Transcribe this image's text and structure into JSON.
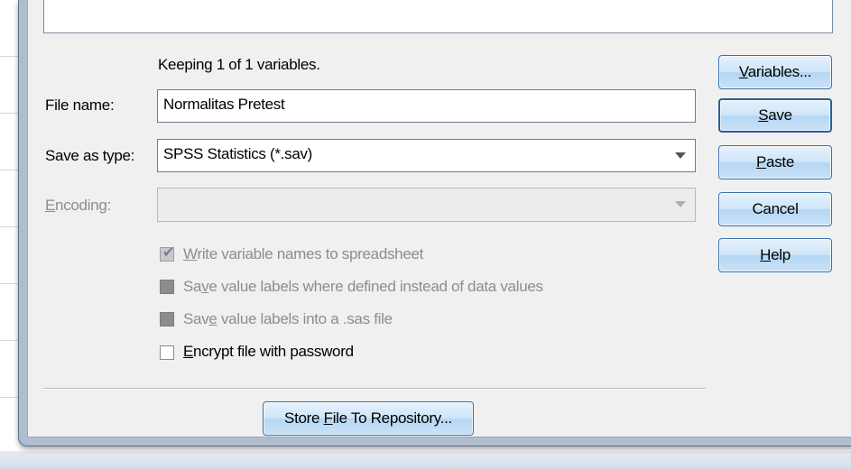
{
  "status": {
    "keeping_text": "Keeping 1 of 1 variables."
  },
  "fields": {
    "file_name_label": "File name:",
    "file_name_value": "Normalitas Pretest",
    "save_as_type_label": "Save as type:",
    "save_as_type_value": "SPSS Statistics (*.sav)",
    "encoding_label_prefix": "",
    "encoding_label_underlined": "E",
    "encoding_label_rest": "ncoding:",
    "encoding_value": ""
  },
  "options": [
    {
      "pre": "",
      "u": "W",
      "post": "rite variable names to spreadsheet",
      "checked": true,
      "enabled": false
    },
    {
      "pre": "Sa",
      "u": "v",
      "post": "e value labels where defined instead of data values",
      "checked": false,
      "enabled": false
    },
    {
      "pre": "Sav",
      "u": "e",
      "post": " value labels into a .sas file",
      "checked": false,
      "enabled": false
    },
    {
      "pre": "",
      "u": "E",
      "post": "ncrypt file with password",
      "checked": false,
      "enabled": true
    }
  ],
  "buttons": {
    "variables": {
      "pre": "",
      "u": "V",
      "post": "ariables..."
    },
    "save": {
      "pre": "",
      "u": "S",
      "post": "ave"
    },
    "paste": {
      "pre": "",
      "u": "P",
      "post": "aste"
    },
    "cancel": {
      "pre": "Cancel",
      "u": "",
      "post": ""
    },
    "help": {
      "pre": "",
      "u": "H",
      "post": "elp"
    },
    "store": {
      "pre": "Store ",
      "u": "F",
      "post": "ile To Repository..."
    }
  },
  "icons": {
    "dropdown": "chevron-down-icon",
    "checkmark": "checkmark-icon"
  }
}
